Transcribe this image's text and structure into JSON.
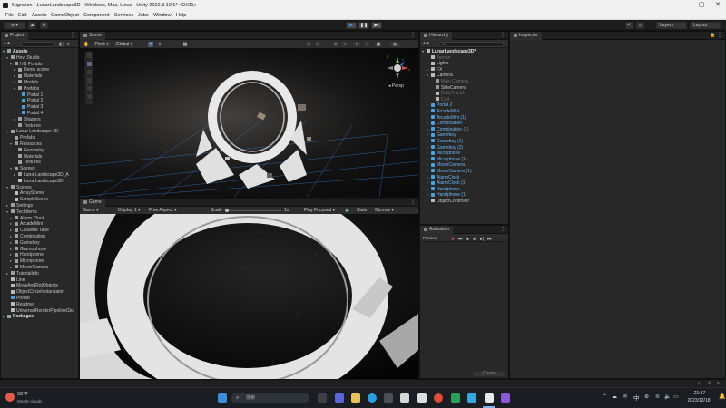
{
  "window": {
    "title": "Migration - LunarLandscape3D - Windows, Mac, Linux - Unity 2022.3.10f1* <DX11>",
    "minimize": "—",
    "maximize": "▢",
    "close": "✕"
  },
  "menu": [
    "File",
    "Edit",
    "Assets",
    "GameObject",
    "Component",
    "Services",
    "Jobs",
    "Window",
    "Help"
  ],
  "toolbar": {
    "account_label": "⊖ ▾",
    "play_icon": "▶",
    "pause_icon": "❚❚",
    "step_icon": "▶|",
    "layers_label": "Layers",
    "layout_label": "Layout"
  },
  "project": {
    "tab": "Project",
    "add_label": "+ ▾",
    "tree": [
      {
        "label": "Assets",
        "depth": 0,
        "arrow": "▾",
        "icon": "folder",
        "bold": true
      },
      {
        "label": "Hovl Studio",
        "depth": 1,
        "arrow": "▾",
        "icon": "folder"
      },
      {
        "label": "HQ Portals",
        "depth": 2,
        "arrow": "▾",
        "icon": "folder"
      },
      {
        "label": "Demo scene",
        "depth": 3,
        "arrow": "▸",
        "icon": "folder"
      },
      {
        "label": "Materials",
        "depth": 3,
        "arrow": "▸",
        "icon": "folder"
      },
      {
        "label": "Models",
        "depth": 3,
        "arrow": "▸",
        "icon": "folder"
      },
      {
        "label": "Prefabs",
        "depth": 3,
        "arrow": "▾",
        "icon": "folder"
      },
      {
        "label": "Portal 1",
        "depth": 4,
        "arrow": "",
        "icon": "prefab"
      },
      {
        "label": "Portal 2",
        "depth": 4,
        "arrow": "",
        "icon": "prefab"
      },
      {
        "label": "Portal 3",
        "depth": 4,
        "arrow": "",
        "icon": "prefab"
      },
      {
        "label": "Portal 4",
        "depth": 4,
        "arrow": "",
        "icon": "prefab"
      },
      {
        "label": "Shaders",
        "depth": 3,
        "arrow": "▸",
        "icon": "folder"
      },
      {
        "label": "Textures",
        "depth": 3,
        "arrow": "",
        "icon": "folder"
      },
      {
        "label": "Lunar Landscape 3D",
        "depth": 1,
        "arrow": "▾",
        "icon": "folder"
      },
      {
        "label": "Prefabs",
        "depth": 2,
        "arrow": "",
        "icon": "folder"
      },
      {
        "label": "Resources",
        "depth": 2,
        "arrow": "▾",
        "icon": "folder"
      },
      {
        "label": "Geometry",
        "depth": 3,
        "arrow": "",
        "icon": "folder"
      },
      {
        "label": "Materials",
        "depth": 3,
        "arrow": "",
        "icon": "folder"
      },
      {
        "label": "Textures",
        "depth": 3,
        "arrow": "",
        "icon": "folder"
      },
      {
        "label": "Scenes",
        "depth": 2,
        "arrow": "▾",
        "icon": "folder"
      },
      {
        "label": "LunarLandscape3D_A",
        "depth": 3,
        "arrow": "▸",
        "icon": "folder"
      },
      {
        "label": "LunarLandscape3D",
        "depth": 3,
        "arrow": "",
        "icon": "scene"
      },
      {
        "label": "Scenes",
        "depth": 1,
        "arrow": "▾",
        "icon": "folder"
      },
      {
        "label": "ArrayScene",
        "depth": 2,
        "arrow": "",
        "icon": "scene"
      },
      {
        "label": "SampleScene",
        "depth": 2,
        "arrow": "",
        "icon": "scene"
      },
      {
        "label": "Settings",
        "depth": 1,
        "arrow": "▸",
        "icon": "folder"
      },
      {
        "label": "TechItems",
        "depth": 1,
        "arrow": "▾",
        "icon": "folder"
      },
      {
        "label": "Alarm Clock",
        "depth": 2,
        "arrow": "▸",
        "icon": "folder"
      },
      {
        "label": "ArcadeMini",
        "depth": 2,
        "arrow": "▸",
        "icon": "folder"
      },
      {
        "label": "Cassette Tape",
        "depth": 2,
        "arrow": "▸",
        "icon": "folder"
      },
      {
        "label": "Combination",
        "depth": 2,
        "arrow": "▸",
        "icon": "folder"
      },
      {
        "label": "Gameboy",
        "depth": 2,
        "arrow": "▸",
        "icon": "folder"
      },
      {
        "label": "Gramophone",
        "depth": 2,
        "arrow": "▸",
        "icon": "folder"
      },
      {
        "label": "Handphone",
        "depth": 2,
        "arrow": "▸",
        "icon": "folder"
      },
      {
        "label": "Microphone",
        "depth": 2,
        "arrow": "▸",
        "icon": "folder"
      },
      {
        "label": "MovieCamera",
        "depth": 2,
        "arrow": "▸",
        "icon": "folder"
      },
      {
        "label": "TutorialInfo",
        "depth": 1,
        "arrow": "▸",
        "icon": "folder"
      },
      {
        "label": "Line",
        "depth": 1,
        "arrow": "",
        "icon": "go"
      },
      {
        "label": "MoveAndRotObjects",
        "depth": 1,
        "arrow": "",
        "icon": "go"
      },
      {
        "label": "ObjectCircleInstantiator",
        "depth": 1,
        "arrow": "",
        "icon": "go"
      },
      {
        "label": "Prefab",
        "depth": 1,
        "arrow": "",
        "icon": "prefab"
      },
      {
        "label": "Readme",
        "depth": 1,
        "arrow": "",
        "icon": "go"
      },
      {
        "label": "UniversalRenderPipelineGlo",
        "depth": 1,
        "arrow": "",
        "icon": "go"
      },
      {
        "label": "Packages",
        "depth": 0,
        "arrow": "▸",
        "icon": "folder",
        "bold": true
      }
    ]
  },
  "scene": {
    "tab": "Scene",
    "game_tab": "Game",
    "tool_pivot": "Pivot ▾",
    "tool_global": "Global ▾",
    "persp_label": "◂ Persp",
    "gizmo_y": "y",
    "gizmo_x": "x",
    "gizmo_z": "z"
  },
  "game": {
    "display_mode": "Game ▾",
    "display": "Display 1 ▾",
    "aspect": "Free Aspect ▾",
    "scale_label": "Scale",
    "scale_value": "1x",
    "play_focused": "Play Focused ▾",
    "stats": "Stats",
    "gizmos": "Gizmos ▾"
  },
  "hierarchy": {
    "tab": "Hierarchy",
    "search_placeholder": "All",
    "items": [
      {
        "label": "LunarLandscape3D*",
        "depth": 0,
        "arrow": "▾",
        "bold": true,
        "icon": "scene"
      },
      {
        "label": "Terrain",
        "depth": 1,
        "arrow": "",
        "dim": true,
        "icon": "go"
      },
      {
        "label": "Lights",
        "depth": 1,
        "arrow": "▸",
        "icon": "go"
      },
      {
        "label": "FX",
        "depth": 1,
        "arrow": "▸",
        "icon": "go"
      },
      {
        "label": "Camera",
        "depth": 1,
        "arrow": "▾",
        "icon": "go"
      },
      {
        "label": "Main Camera",
        "depth": 2,
        "arrow": "",
        "dim": true,
        "icon": "cam"
      },
      {
        "label": "SideCamera",
        "depth": 2,
        "arrow": "",
        "icon": "cam"
      },
      {
        "label": "DollyTrack1",
        "depth": 2,
        "arrow": "",
        "dim": true,
        "icon": "go"
      },
      {
        "label": "Cart",
        "depth": 2,
        "arrow": "",
        "dim": true,
        "icon": "go"
      },
      {
        "label": "Portal 2",
        "depth": 1,
        "arrow": "▸",
        "blue": true,
        "icon": "prefab"
      },
      {
        "label": "ArcadeMini",
        "depth": 1,
        "arrow": "▸",
        "blue": true,
        "icon": "prefab"
      },
      {
        "label": "ArcadeMini (1)",
        "depth": 1,
        "arrow": "▸",
        "blue": true,
        "icon": "prefab"
      },
      {
        "label": "Combination",
        "depth": 1,
        "arrow": "▸",
        "blue": true,
        "icon": "prefab"
      },
      {
        "label": "Combination (1)",
        "depth": 1,
        "arrow": "▸",
        "blue": true,
        "icon": "prefab"
      },
      {
        "label": "Gameboy",
        "depth": 1,
        "arrow": "▸",
        "blue": true,
        "icon": "prefab"
      },
      {
        "label": "Gameboy (1)",
        "depth": 1,
        "arrow": "▸",
        "blue": true,
        "icon": "prefab"
      },
      {
        "label": "Gameboy (2)",
        "depth": 1,
        "arrow": "▸",
        "blue": true,
        "icon": "prefab"
      },
      {
        "label": "Microphone",
        "depth": 1,
        "arrow": "▸",
        "blue": true,
        "icon": "prefab"
      },
      {
        "label": "Microphone (1)",
        "depth": 1,
        "arrow": "▸",
        "blue": true,
        "icon": "prefab"
      },
      {
        "label": "MovieCamera",
        "depth": 1,
        "arrow": "▸",
        "blue": true,
        "icon": "prefab"
      },
      {
        "label": "MovieCamera (1)",
        "depth": 1,
        "arrow": "▸",
        "blue": true,
        "icon": "prefab"
      },
      {
        "label": "AlarmClock",
        "depth": 1,
        "arrow": "▸",
        "blue": true,
        "icon": "prefab"
      },
      {
        "label": "AlarmClock (1)",
        "depth": 1,
        "arrow": "▸",
        "blue": true,
        "icon": "prefab"
      },
      {
        "label": "Handphone",
        "depth": 1,
        "arrow": "▸",
        "blue": true,
        "icon": "prefab"
      },
      {
        "label": "Handphone (1)",
        "depth": 1,
        "arrow": "▸",
        "blue": true,
        "icon": "prefab"
      },
      {
        "label": "ObjectController",
        "depth": 1,
        "arrow": "",
        "icon": "go"
      }
    ]
  },
  "animation": {
    "tab": "Animation",
    "preview_label": "Preview",
    "create_label": "Create"
  },
  "inspector": {
    "tab": "Inspector"
  },
  "taskbar": {
    "weather_temp": "59°F",
    "weather_desc": "Mostly cloudy",
    "search_placeholder": "搜索",
    "lang": "中",
    "time": "21:37",
    "date": "2023/12/18"
  },
  "colors": {
    "accent_blue": "#4a90d9",
    "prefab_blue": "#6fb3ec",
    "panel_bg": "#282828"
  }
}
